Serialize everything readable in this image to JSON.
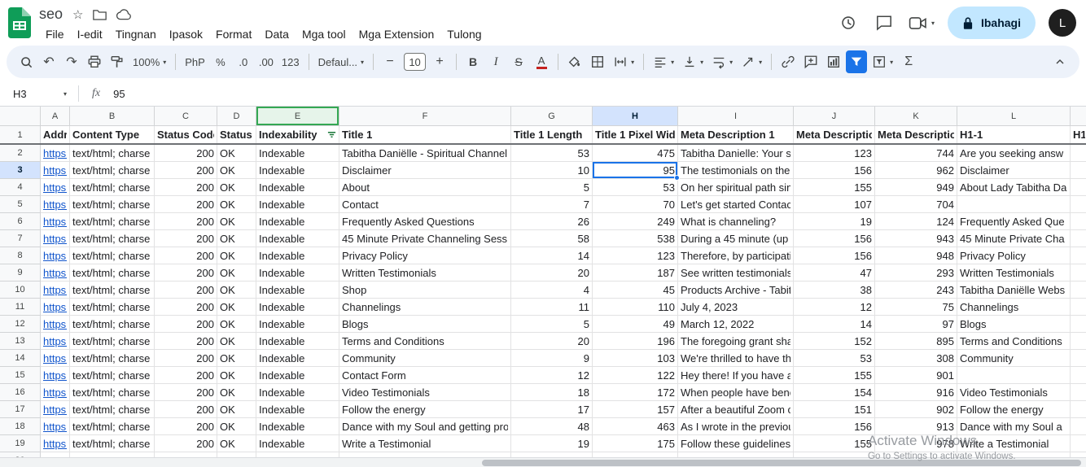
{
  "titlebar": {
    "doc_title": "seo",
    "menus": [
      "File",
      "I-edit",
      "Tingnan",
      "Ipasok",
      "Format",
      "Data",
      "Mga tool",
      "Mga Extension",
      "Tulong"
    ],
    "share_label": "Ibahagi",
    "avatar_letter": "L"
  },
  "icons": {
    "star": "☆",
    "chevron_down": "▾",
    "undo": "↶",
    "redo": "↷",
    "minus": "−",
    "plus": "+"
  },
  "toolbar": {
    "zoom": "100%",
    "currency": "PhP",
    "percent": "%",
    "decimal_decrease": ".0",
    "decimal_increase": ".00",
    "number_format": "123",
    "font": "Defaul...",
    "font_size": "10",
    "bold": "B",
    "italic": "I",
    "strikethrough": "S",
    "text_color": "A",
    "functions": "Σ"
  },
  "formula_bar": {
    "cell_ref": "H3",
    "fx_label": "fx",
    "value": "95"
  },
  "grid": {
    "col_letters": [
      "A",
      "B",
      "C",
      "D",
      "E",
      "F",
      "G",
      "H",
      "I",
      "J",
      "K",
      "L"
    ],
    "selected_col": "H",
    "selected_row": 3,
    "filtered_col": "E",
    "header_row": [
      "Addres",
      "Content Type",
      "Status Code",
      "Status",
      "Indexability",
      "Title 1",
      "Title 1 Length",
      "Title 1 Pixel Wid",
      "Meta Description 1",
      "Meta Descriptio",
      "Meta Descriptio",
      "H1-1",
      "H1"
    ],
    "rows": [
      {
        "n": 2,
        "cells": [
          "https://t",
          "text/html; charse",
          "200",
          "OK",
          "Indexable",
          "Tabitha Daniëlle - Spiritual Channel",
          "53",
          "475",
          "Tabitha Danielle: Your s",
          "123",
          "744",
          "Are you seeking answ",
          ""
        ]
      },
      {
        "n": 3,
        "cells": [
          "https://t",
          "text/html; charse",
          "200",
          "OK",
          "Indexable",
          "Disclaimer",
          "10",
          "95",
          "The testimonials on the",
          "156",
          "962",
          "Disclaimer",
          ""
        ]
      },
      {
        "n": 4,
        "cells": [
          "https://t",
          "text/html; charse",
          "200",
          "OK",
          "Indexable",
          "About",
          "5",
          "53",
          "On her spiritual path sin",
          "155",
          "949",
          "About Lady Tabitha Da",
          ""
        ]
      },
      {
        "n": 5,
        "cells": [
          "https://t",
          "text/html; charse",
          "200",
          "OK",
          "Indexable",
          "Contact",
          "7",
          "70",
          "Let's get started Contac",
          "107",
          "704",
          "",
          ""
        ]
      },
      {
        "n": 6,
        "cells": [
          "https://t",
          "text/html; charse",
          "200",
          "OK",
          "Indexable",
          "Frequently Asked Questions",
          "26",
          "249",
          "What is channeling?",
          "19",
          "124",
          "Frequently Asked Que",
          ""
        ]
      },
      {
        "n": 7,
        "cells": [
          "https://t",
          "text/html; charse",
          "200",
          "OK",
          "Indexable",
          "45 Minute Private Channeling Sess",
          "58",
          "538",
          "During a 45 minute (up",
          "156",
          "943",
          "45 Minute Private Cha",
          ""
        ]
      },
      {
        "n": 8,
        "cells": [
          "https://t",
          "text/html; charse",
          "200",
          "OK",
          "Indexable",
          "Privacy Policy",
          "14",
          "123",
          "Therefore, by participati",
          "156",
          "948",
          "Privacy Policy",
          ""
        ]
      },
      {
        "n": 9,
        "cells": [
          "https://t",
          "text/html; charse",
          "200",
          "OK",
          "Indexable",
          "Written Testimonials",
          "20",
          "187",
          "See written testimonials",
          "47",
          "293",
          "Written Testimonials",
          ""
        ]
      },
      {
        "n": 10,
        "cells": [
          "https://t",
          "text/html; charse",
          "200",
          "OK",
          "Indexable",
          "Shop",
          "4",
          "45",
          "Products Archive - Tabit",
          "38",
          "243",
          "Tabitha Daniëlle Webs",
          ""
        ]
      },
      {
        "n": 11,
        "cells": [
          "https://t",
          "text/html; charse",
          "200",
          "OK",
          "Indexable",
          "Channelings",
          "11",
          "110",
          "July 4, 2023",
          "12",
          "75",
          "Channelings",
          ""
        ]
      },
      {
        "n": 12,
        "cells": [
          "https://t",
          "text/html; charse",
          "200",
          "OK",
          "Indexable",
          "Blogs",
          "5",
          "49",
          "March 12, 2022",
          "14",
          "97",
          "Blogs",
          ""
        ]
      },
      {
        "n": 13,
        "cells": [
          "https://t",
          "text/html; charse",
          "200",
          "OK",
          "Indexable",
          "Terms and Conditions",
          "20",
          "196",
          "The foregoing grant sha",
          "152",
          "895",
          "Terms and Conditions",
          ""
        ]
      },
      {
        "n": 14,
        "cells": [
          "https://t",
          "text/html; charse",
          "200",
          "OK",
          "Indexable",
          "Community",
          "9",
          "103",
          "We're thrilled to have th",
          "53",
          "308",
          "Community",
          ""
        ]
      },
      {
        "n": 15,
        "cells": [
          "https://t",
          "text/html; charse",
          "200",
          "OK",
          "Indexable",
          "Contact Form",
          "12",
          "122",
          "Hey there! If you have a",
          "155",
          "901",
          "",
          ""
        ]
      },
      {
        "n": 16,
        "cells": [
          "https://t",
          "text/html; charse",
          "200",
          "OK",
          "Indexable",
          "Video Testimonials",
          "18",
          "172",
          "When people have bene",
          "154",
          "916",
          "Video Testimonials",
          ""
        ]
      },
      {
        "n": 17,
        "cells": [
          "https://t",
          "text/html; charse",
          "200",
          "OK",
          "Indexable",
          "Follow the energy",
          "17",
          "157",
          "After a beautiful Zoom c",
          "151",
          "902",
          "Follow the energy",
          ""
        ]
      },
      {
        "n": 18,
        "cells": [
          "https://t",
          "text/html; charse",
          "200",
          "OK",
          "Indexable",
          "Dance with my Soul and getting pro",
          "48",
          "463",
          "As I wrote in the previou",
          "156",
          "913",
          "Dance with my Soul a",
          ""
        ]
      },
      {
        "n": 19,
        "cells": [
          "https://t",
          "text/html; charse",
          "200",
          "OK",
          "Indexable",
          "Write a Testimonial",
          "19",
          "175",
          "Follow these guidelines",
          "155",
          "978",
          "Write a Testimonial",
          ""
        ]
      }
    ]
  },
  "watermark": {
    "title": "Activate Windows",
    "subtitle": "Go to Settings to activate Windows."
  }
}
